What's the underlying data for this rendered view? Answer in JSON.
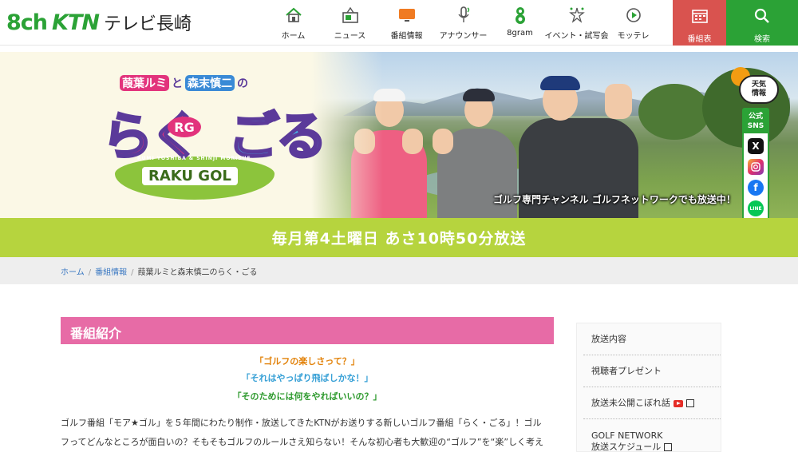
{
  "header": {
    "logo_8ch": "8ch",
    "logo_ktn": "KTN",
    "logo_tv": "テレビ長崎",
    "nav": [
      {
        "label": "ホーム",
        "icon": "home-icon"
      },
      {
        "label": "ニュース",
        "icon": "news-icon"
      },
      {
        "label": "番組情報",
        "icon": "tv-icon"
      },
      {
        "label": "アナウンサー",
        "icon": "microphone-icon"
      },
      {
        "label": "8gram",
        "icon": "8gram-icon"
      },
      {
        "label": "イベント・試写会",
        "icon": "event-icon"
      },
      {
        "label": "モッテレ",
        "icon": "play-icon"
      }
    ],
    "schedule_label": "番組表",
    "search_label": "検索"
  },
  "hero": {
    "logo_names_a": "葭葉ルミ",
    "logo_names_to": "と",
    "logo_names_b": "森末慎二",
    "logo_names_no": "の",
    "logo_title_a": "らく",
    "logo_rg": "RG",
    "logo_title_b": "ごる",
    "logo_sub": "RUMI YOSHIBA & SHINJI MORISUE",
    "logo_raku_gol": "RAKU GOL",
    "caption": "ゴルフ専門チャンネル ゴルフネットワークでも放送中！"
  },
  "side_panel": {
    "weather": "天気\n情報",
    "sns_head": "公式\nSNS",
    "sns": [
      "x-icon",
      "instagram-icon",
      "facebook-icon",
      "line-icon",
      "youtube-icon"
    ]
  },
  "band": {
    "text": "毎月第4土曜日 あさ10時50分放送"
  },
  "breadcrumb": {
    "home": "ホーム",
    "info": "番組情報",
    "current": "葭葉ルミと森末慎二のらく・ごる"
  },
  "main": {
    "section_title": "番組紹介",
    "catch1": "「ゴルフの楽しさって？」",
    "catch2": "「それはやっぱり飛ばしかな！」",
    "catch3": "「そのためには何をやればいいの？」",
    "body_line1": "ゴルフ番組「モア★ゴル」を５年間にわたり制作・放送してきたKTNがお送りする新しいゴルフ番組「らく・ごる」！ゴル",
    "body_line2": "フってどんなところが面白いの？そもそもゴルフのルールさえ知らない！そんな初心者も大歓迎の“ゴルフ”を“楽”しく考え"
  },
  "menu": {
    "items": [
      "放送内容",
      "視聴者プレゼント",
      "放送未公開こぼれ話",
      "GOLF NETWORK",
      "放送スケジュール"
    ]
  },
  "colors": {
    "brand_green": "#2ba236",
    "band_green": "#b6d43e",
    "pink": "#e76ba6",
    "red_button": "#d9534f"
  }
}
